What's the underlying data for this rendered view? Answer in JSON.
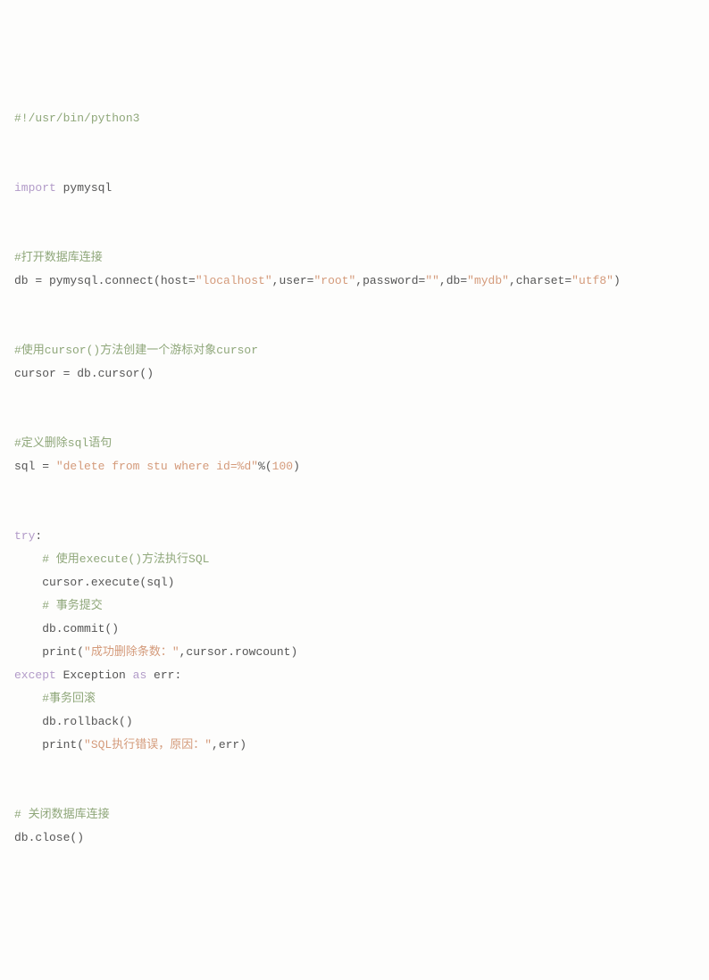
{
  "code": {
    "l01_shebang": "#!/usr/bin/python3",
    "l03_kw_import": "import",
    "l03_mod": " pymysql",
    "l05_cm_open": "#打开数据库连接",
    "l06_a": "db = pymysql.connect(host=",
    "l06_s1": "\"localhost\"",
    "l06_b": ",user=",
    "l06_s2": "\"root\"",
    "l06_c": ",password=",
    "l06_s3": "\"\"",
    "l06_d": ",db=",
    "l06_s4": "\"mydb\"",
    "l06_e": ",charset=",
    "l06_s5": "\"utf8\"",
    "l06_f": ")",
    "l08_cm_cursor": "#使用cursor()方法创建一个游标对象cursor",
    "l09": "cursor = db.cursor()",
    "l11_cm_sql": "#定义删除sql语句",
    "l12_a": "sql = ",
    "l12_s": "\"delete from stu where id=%d\"",
    "l12_b": "%(",
    "l12_n": "100",
    "l12_c": ")",
    "l14_try": "try",
    "l14_colon": ":",
    "l15_cm": "    # 使用execute()方法执行SQL",
    "l16": "    cursor.execute(sql)",
    "l17_cm": "    # 事务提交",
    "l18": "    db.commit()",
    "l19_a": "    print(",
    "l19_s": "\"成功删除条数：\"",
    "l19_b": ",cursor.rowcount)",
    "l20_except": "except",
    "l20_mid": " Exception ",
    "l20_as": "as",
    "l20_err": " err:",
    "l21_cm": "    #事务回滚",
    "l22": "    db.rollback()",
    "l23_a": "    print(",
    "l23_s": "\"SQL执行错误，原因：\"",
    "l23_b": ",err)",
    "l25_cm_close": "# 关闭数据库连接",
    "l26": "db.close()"
  }
}
